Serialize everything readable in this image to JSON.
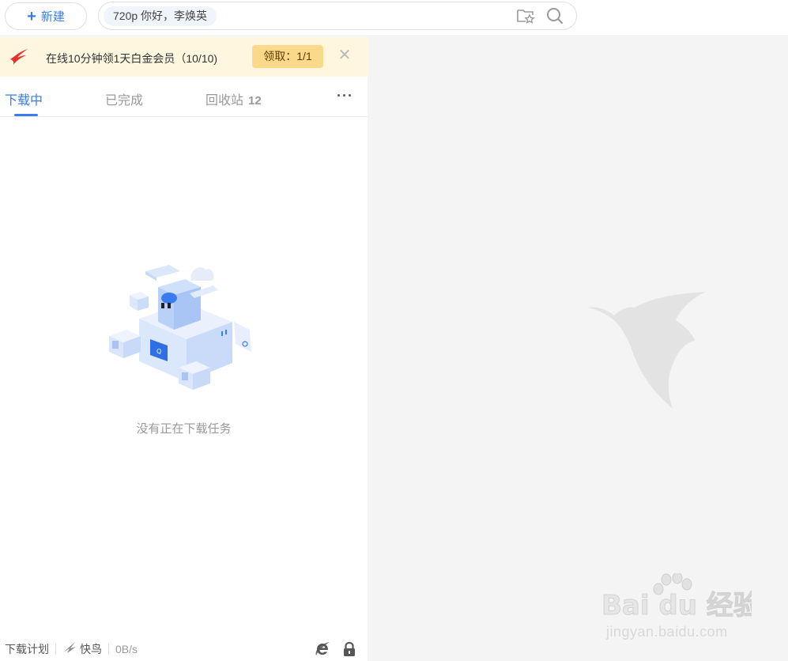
{
  "topbar": {
    "new_button_label": "新建",
    "search_tag": "720p  你好，李焕英"
  },
  "banner": {
    "text": "在线10分钟领1天白金会员（10/10)",
    "claim_label": "领取：1/1",
    "close_glyph": "✕"
  },
  "tabs": {
    "items": [
      {
        "label": "下载中"
      },
      {
        "label": "已完成"
      },
      {
        "label": "回收站",
        "count": "12"
      }
    ],
    "more_glyph": "···"
  },
  "empty_state": {
    "message": "没有正在下载任务"
  },
  "statusbar": {
    "plan_label": "下载计划",
    "kuainiao_label": "快鸟",
    "speed": "0B/s"
  },
  "watermark": {
    "brand": "Bai du 经验",
    "url": "jingyan.baidu.com"
  },
  "colors": {
    "accent": "#3a7bf0",
    "banner_bg": "#fff6df",
    "claim_bg": "#fbd98a",
    "right_panel_bg": "#f4f4f4"
  }
}
